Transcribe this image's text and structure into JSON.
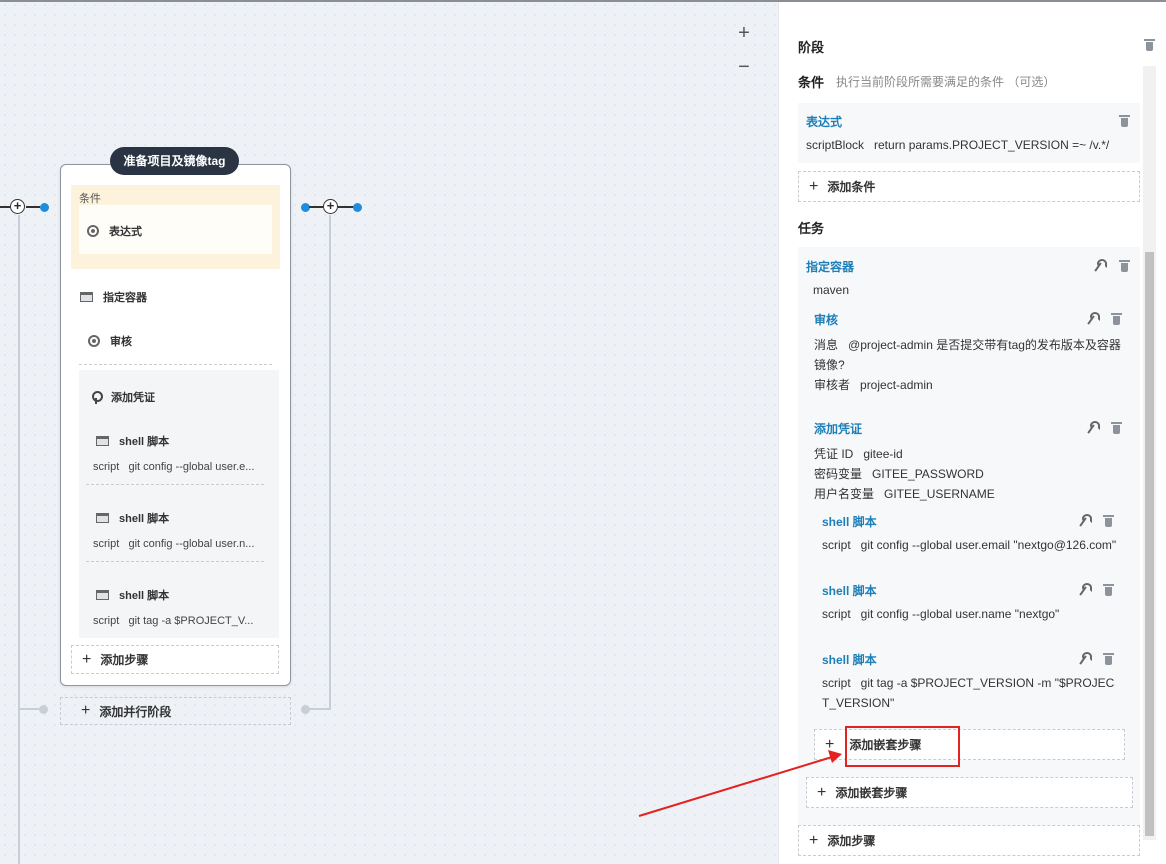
{
  "canvas": {
    "zoom_in": "+",
    "zoom_out": "−"
  },
  "stage": {
    "title": "准备项目及镜像tag",
    "condition_label": "条件",
    "condition_step": "表达式",
    "steps": [
      {
        "label": "指定容器",
        "icon": "terminal-icon"
      },
      {
        "label": "审核",
        "icon": "circle-icon"
      }
    ],
    "credential_step": "添加凭证",
    "shell_steps": [
      {
        "label": "shell 脚本",
        "script_key": "script",
        "script_value": "git config --global user.e..."
      },
      {
        "label": "shell 脚本",
        "script_key": "script",
        "script_value": "git config --global user.n..."
      },
      {
        "label": "shell 脚本",
        "script_key": "script",
        "script_value": "git tag -a $PROJECT_V..."
      }
    ],
    "add_step": "添加步骤",
    "add_parallel": "添加并行阶段"
  },
  "panel": {
    "stage_heading": "阶段",
    "condition_heading": "条件",
    "condition_hint": "执行当前阶段所需要满足的条件 （可选）",
    "expression": {
      "title": "表达式",
      "key": "scriptBlock",
      "value": "return params.PROJECT_VERSION =~ /v.*/"
    },
    "add_condition": "添加条件",
    "task_heading": "任务",
    "container": {
      "title": "指定容器",
      "value": "maven"
    },
    "review": {
      "title": "审核",
      "message_key": "消息",
      "message_value_1": "@project-admin 是否提交带有tag的发布版本及容器",
      "message_value_2": "镜像?",
      "reviewer_key": "审核者",
      "reviewer_value": "project-admin"
    },
    "credential": {
      "title": "添加凭证",
      "id_key": "凭证 ID",
      "id_value": "gitee-id",
      "pwd_key": "密码变量",
      "pwd_value": "GITEE_PASSWORD",
      "user_key": "用户名变量",
      "user_value": "GITEE_USERNAME"
    },
    "shells": [
      {
        "title": "shell 脚本",
        "key": "script",
        "value": "git config --global user.email \"nextgo@126.com\""
      },
      {
        "title": "shell 脚本",
        "key": "script",
        "value": "git config --global user.name \"nextgo\""
      },
      {
        "title": "shell 脚本",
        "key": "script",
        "value_1": "git tag -a $PROJECT_VERSION -m \"$PROJEC",
        "value_2": "T_VERSION\""
      }
    ],
    "add_nested_inner": "添加嵌套步骤",
    "add_nested_outer": "添加嵌套步骤",
    "add_step": "添加步骤"
  },
  "colors": {
    "accent": "#1d7fb8",
    "stage_title_bg": "#2a3442",
    "highlight": "#e32222",
    "condition_bg": "#fdf3dc"
  }
}
